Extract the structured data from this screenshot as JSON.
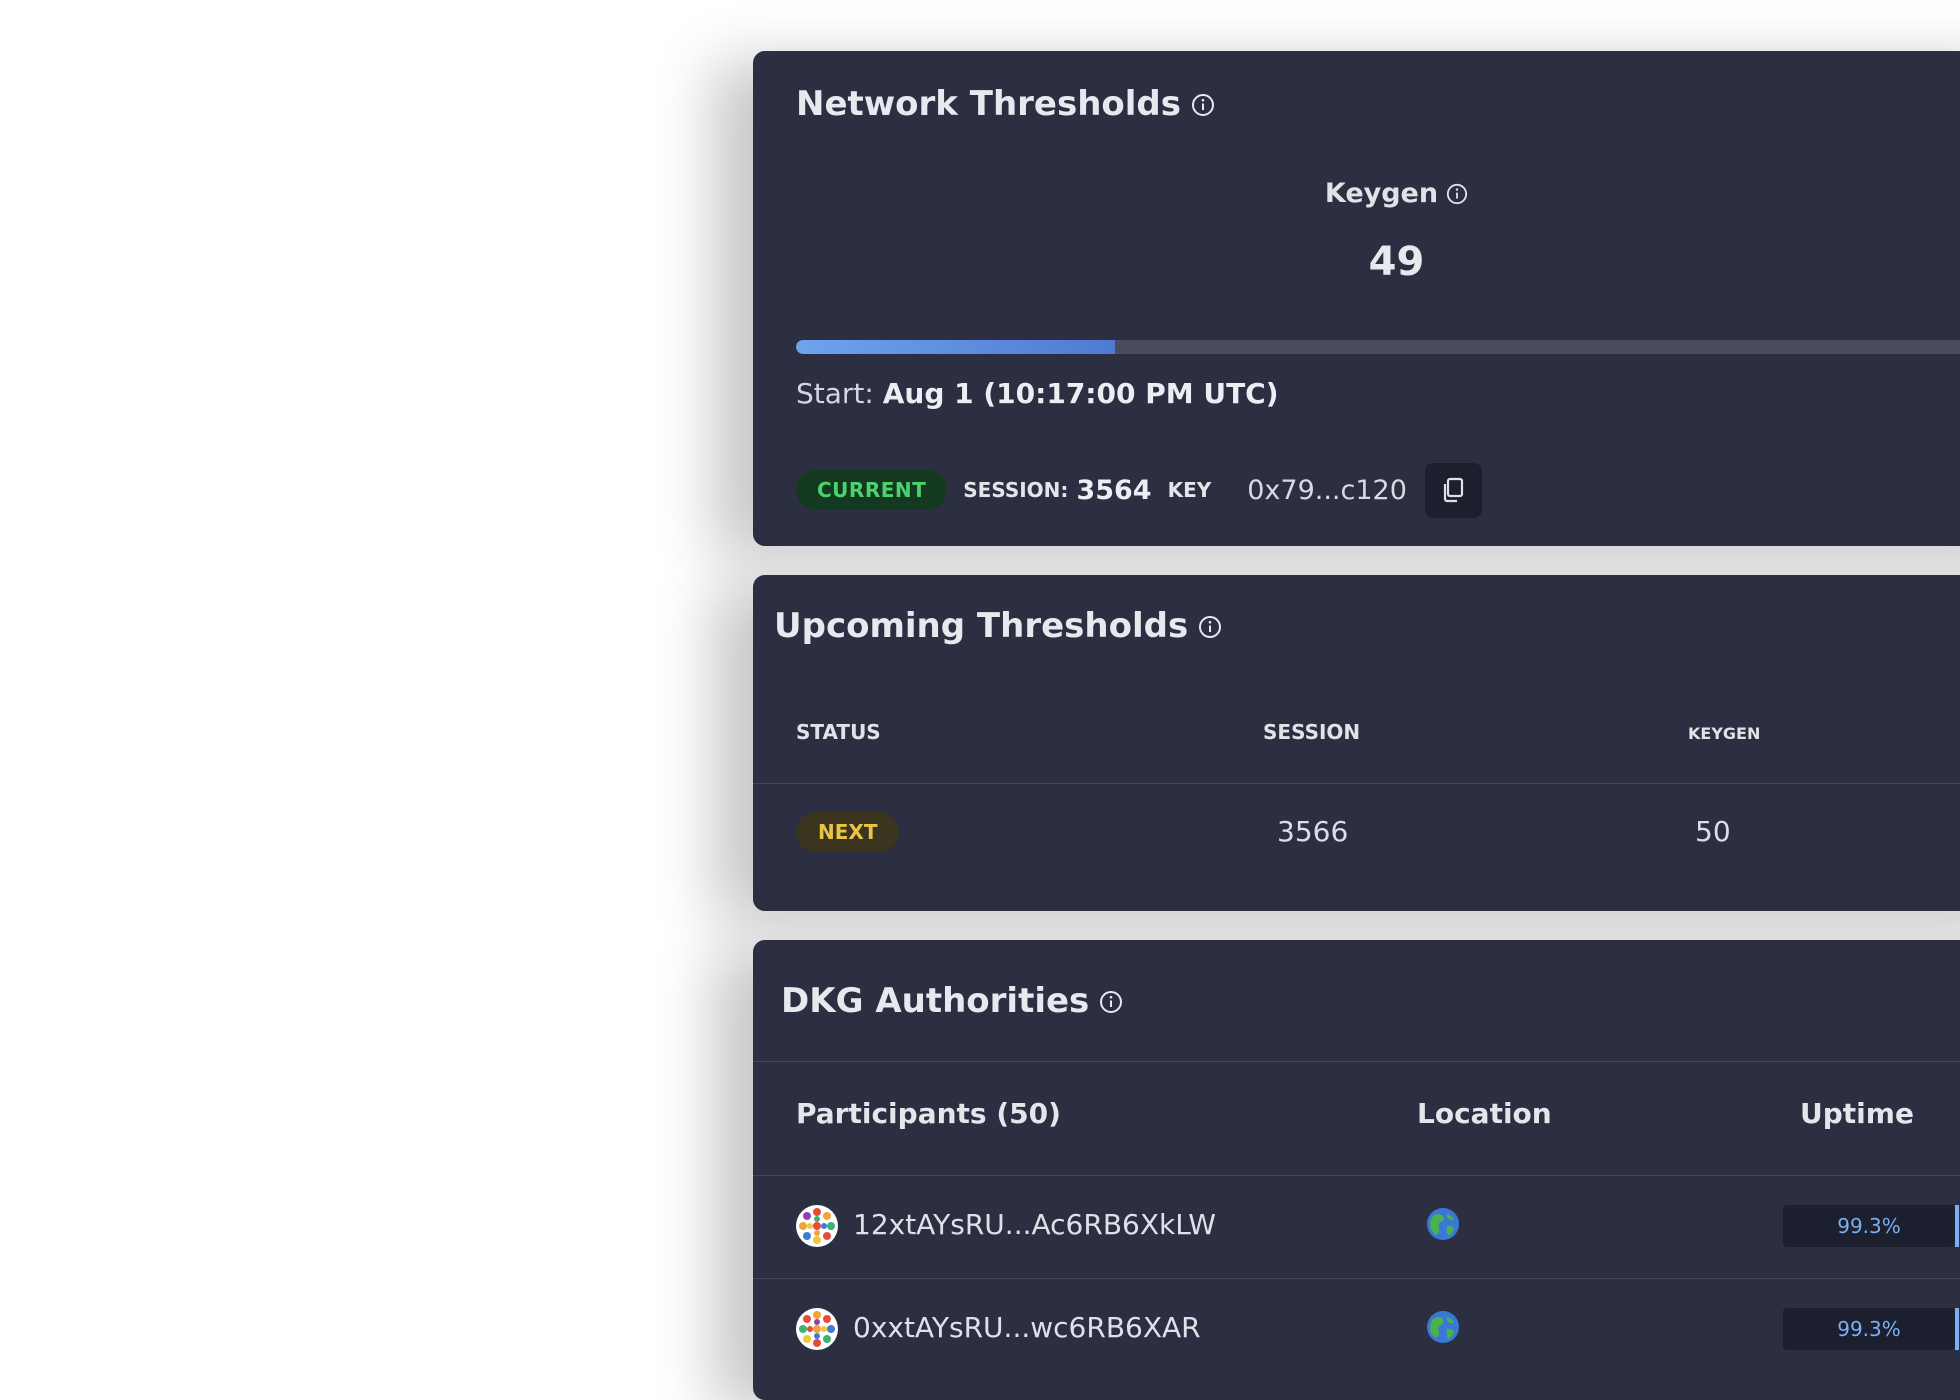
{
  "network": {
    "title": "Network Thresholds",
    "keygen_label": "Keygen",
    "keygen_value": "49",
    "progress_fraction": 0.254,
    "start_label": "Start:",
    "start_value": "Aug 1 (10:17:00 PM UTC)",
    "status_badge": "CURRENT",
    "session_label": "SESSION:",
    "session_value": "3564",
    "key_label": "KEY",
    "key_value": "0x79...c120",
    "copy_icon": "copy-icon"
  },
  "upcoming": {
    "title": "Upcoming Thresholds",
    "columns": [
      "STATUS",
      "SESSION",
      "KEYGEN"
    ],
    "rows": [
      {
        "status": "NEXT",
        "session": "3566",
        "keygen": "50"
      }
    ]
  },
  "dkg": {
    "title": "DKG Authorities",
    "columns": [
      "Participants (50)",
      "Location",
      "Uptime"
    ],
    "participants": [
      {
        "address": "12xtAYsRU...Ac6RB6XkLW",
        "location_icon": "globe-icon",
        "uptime": "99.3%"
      },
      {
        "address": "0xxtAYsRU...wc6RB6XAR",
        "location_icon": "globe-icon",
        "uptime": "99.3%"
      }
    ]
  },
  "colors": {
    "card_bg": "#2c2f41",
    "accent_blue": "#6fa3ee",
    "current_green": "#4bd26e",
    "next_yellow": "#eac545",
    "uptime_blue": "#79b0f3"
  }
}
